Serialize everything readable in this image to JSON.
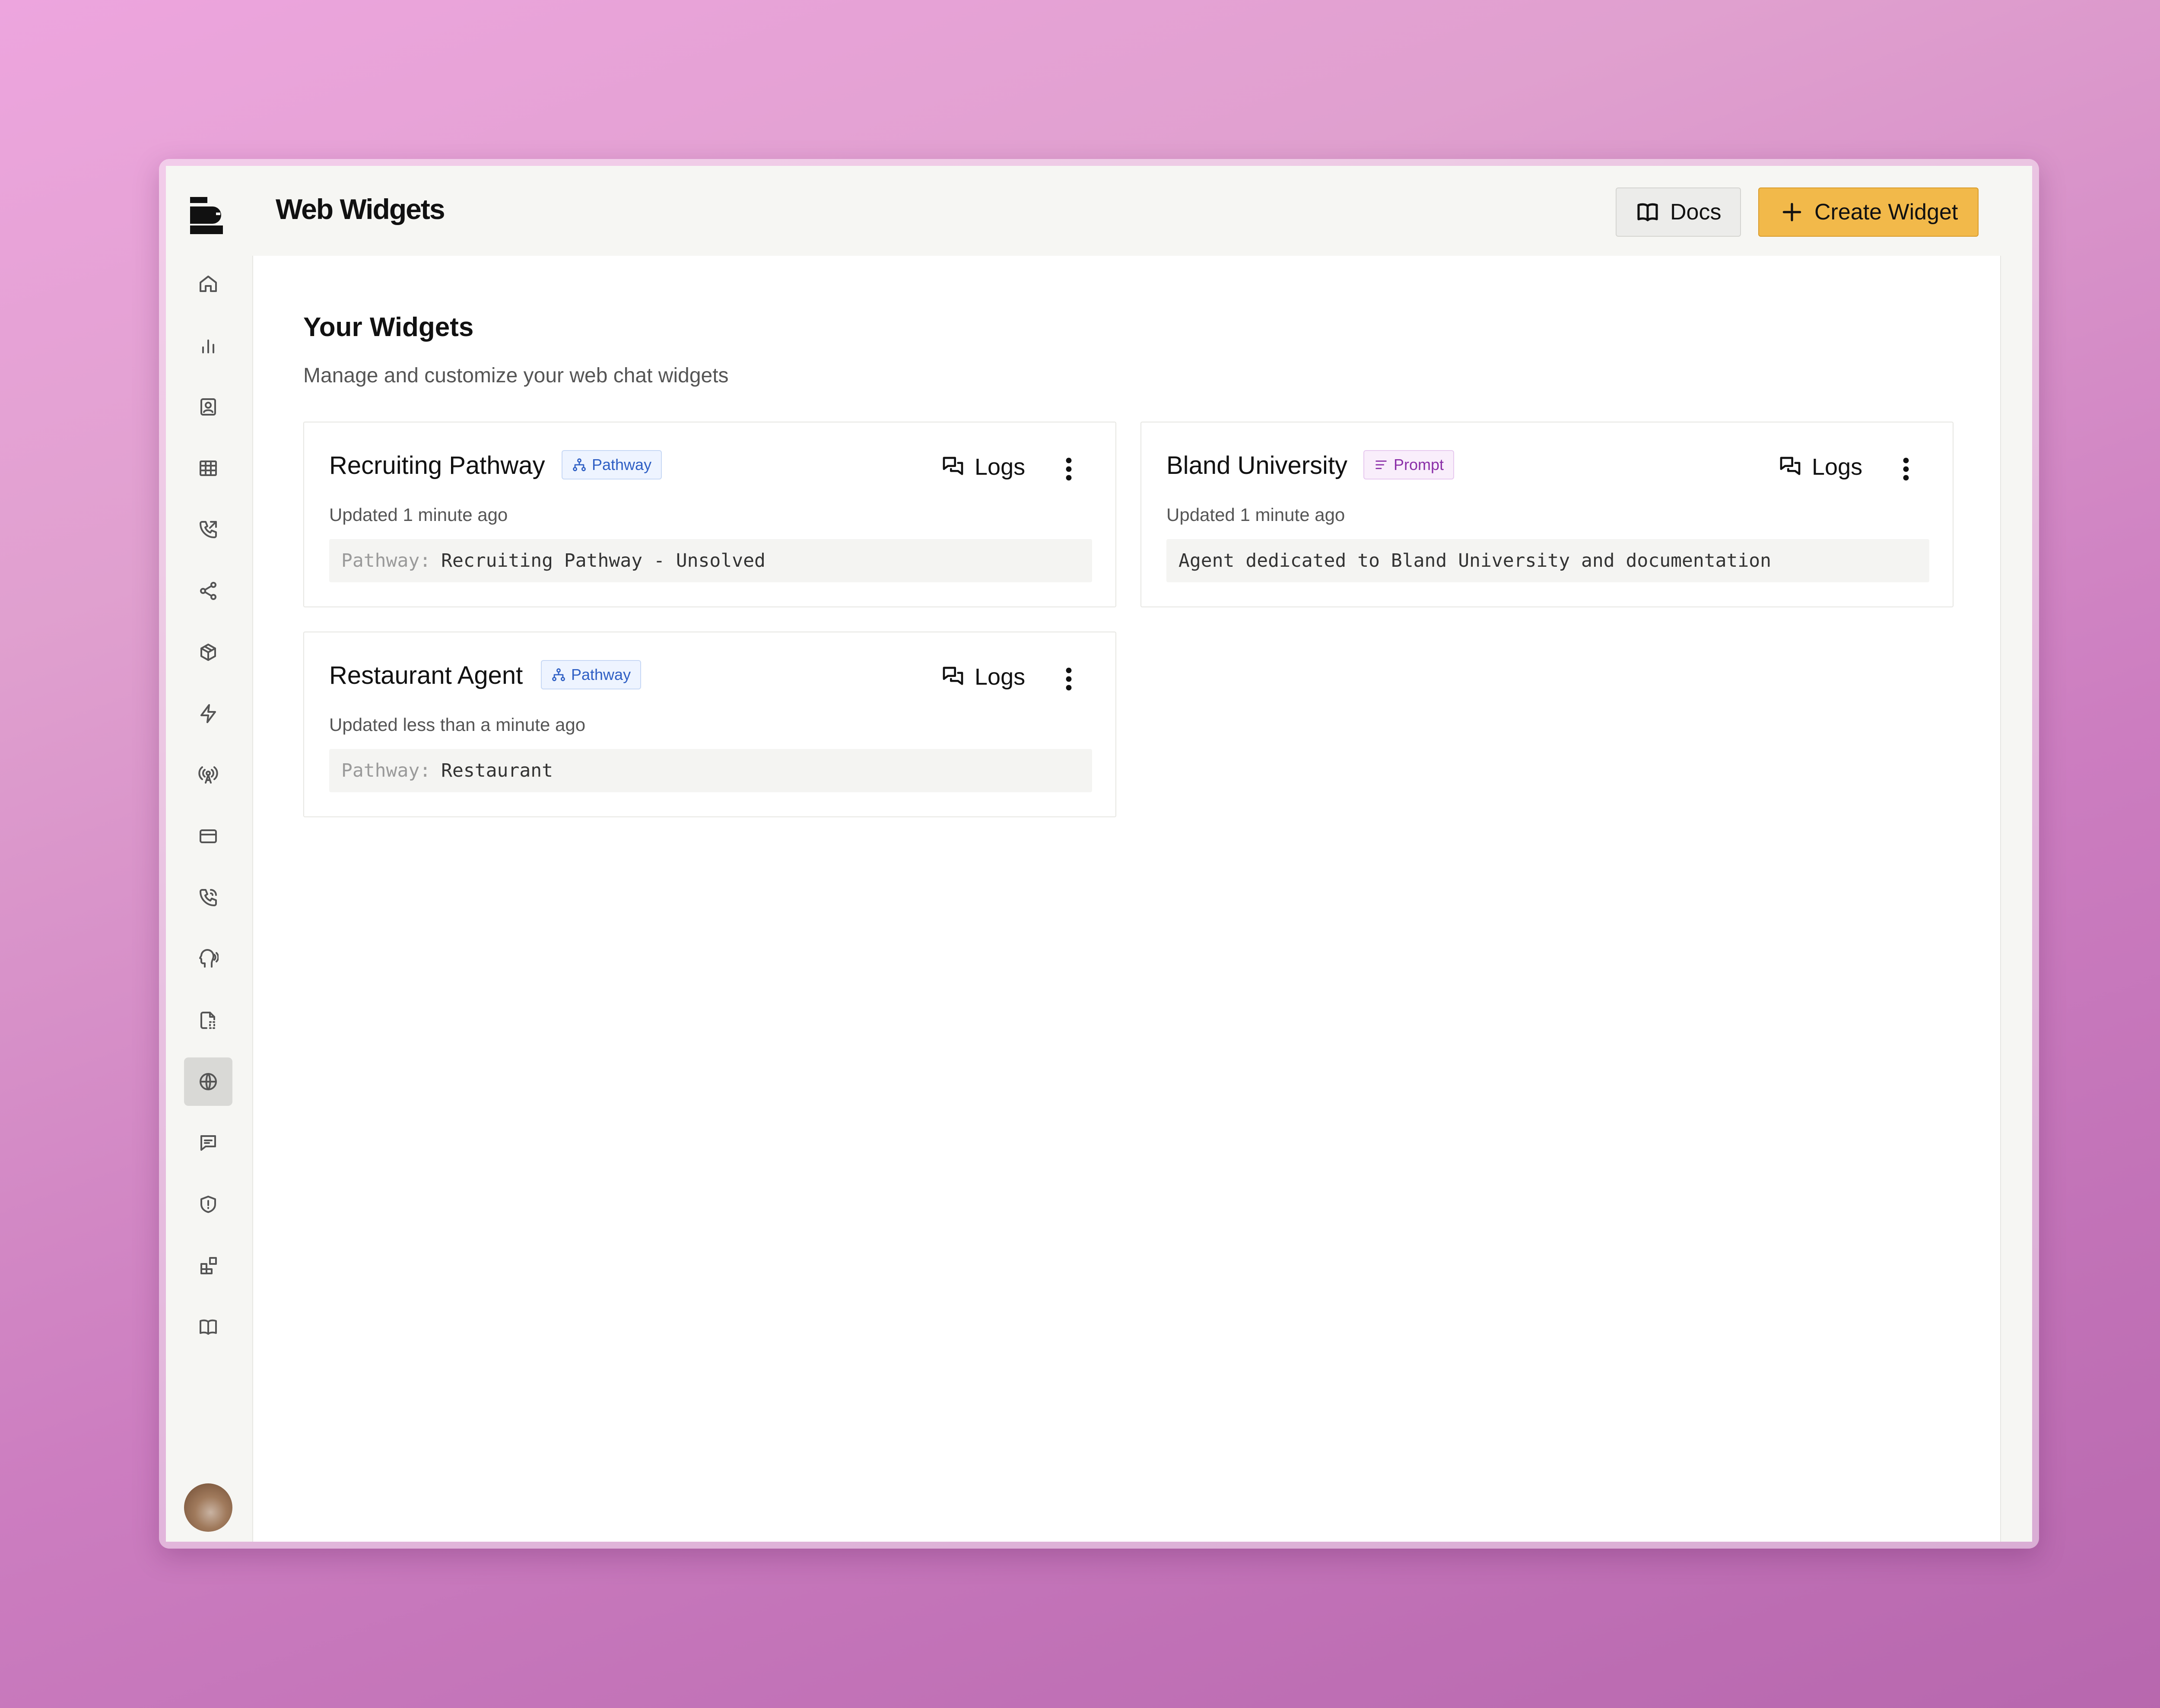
{
  "header": {
    "title": "Web Widgets",
    "docs_label": "Docs",
    "create_label": "Create Widget"
  },
  "sidebar": {
    "items": [
      {
        "icon": "home-icon"
      },
      {
        "icon": "bar-chart-icon"
      },
      {
        "icon": "contact-icon"
      },
      {
        "icon": "table-icon"
      },
      {
        "icon": "phone-outgoing-icon"
      },
      {
        "icon": "share-icon"
      },
      {
        "icon": "box-icon"
      },
      {
        "icon": "lightning-icon"
      },
      {
        "icon": "broadcast-icon"
      },
      {
        "icon": "credit-card-icon"
      },
      {
        "icon": "phone-call-icon"
      },
      {
        "icon": "voice-head-icon"
      },
      {
        "icon": "file-dashed-icon"
      },
      {
        "icon": "globe-icon",
        "active": true
      },
      {
        "icon": "message-square-icon"
      },
      {
        "icon": "shield-alert-icon"
      },
      {
        "icon": "blocks-icon"
      },
      {
        "icon": "book-icon"
      }
    ]
  },
  "main": {
    "title": "Your Widgets",
    "subtitle": "Manage and customize your web chat widgets"
  },
  "widgets": [
    {
      "name": "Recruiting Pathway",
      "badge": "Pathway",
      "logs_label": "Logs",
      "updated": "Updated 1 minute ago",
      "code_key": "Pathway:",
      "code_value": "Recruiting Pathway - Unsolved"
    },
    {
      "name": "Bland University",
      "badge": "Prompt",
      "logs_label": "Logs",
      "updated": "Updated 1 minute ago",
      "code_key": "",
      "code_value": "Agent dedicated to Bland University and documentation"
    },
    {
      "name": "Restaurant Agent",
      "badge": "Pathway",
      "logs_label": "Logs",
      "updated": "Updated less than a minute ago",
      "code_key": "Pathway:",
      "code_value": "Restaurant"
    }
  ],
  "colors": {
    "accent": "#f2b94a",
    "pathway_badge": "#2f5fc4",
    "prompt_badge": "#8b2fa8"
  }
}
